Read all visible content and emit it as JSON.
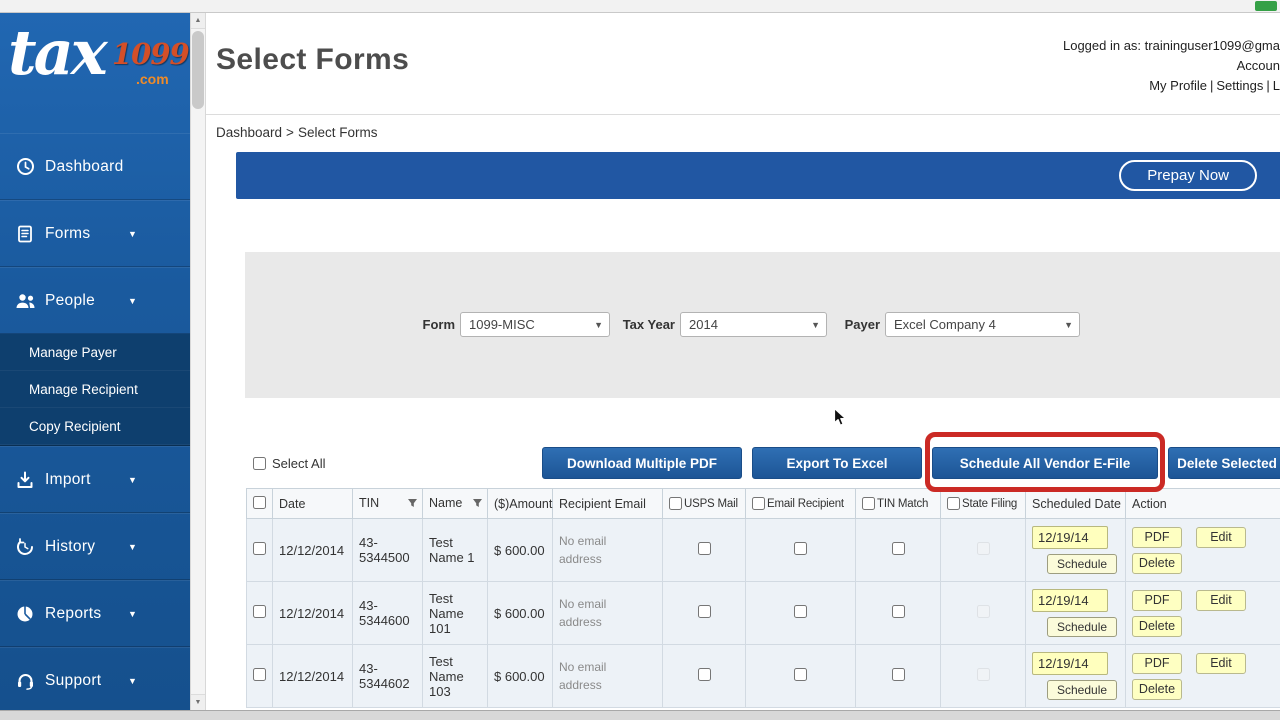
{
  "sidebar": {
    "logo": {
      "word": "tax",
      "number": "1099",
      "domain": ".com"
    },
    "items": [
      {
        "label": "Dashboard",
        "icon": "dashboard-clock-icon",
        "has_arrow": false
      },
      {
        "label": "Forms",
        "icon": "forms-icon",
        "has_arrow": true
      },
      {
        "label": "People",
        "icon": "people-icon",
        "has_arrow": true
      },
      {
        "label": "Import",
        "icon": "import-icon",
        "has_arrow": true
      },
      {
        "label": "History",
        "icon": "history-icon",
        "has_arrow": true
      },
      {
        "label": "Reports",
        "icon": "reports-pie-icon",
        "has_arrow": true
      },
      {
        "label": "Support",
        "icon": "support-headset-icon",
        "has_arrow": true
      }
    ],
    "people_submenu": [
      "Manage Payer",
      "Manage Recipient",
      "Copy Recipient"
    ]
  },
  "header": {
    "title": "Select Forms",
    "logged_in": "Logged in as: traininguser1099@gma",
    "account_line": "Accoun",
    "links": {
      "profile": "My Profile",
      "settings": "Settings",
      "logout": "L",
      "separator": "|"
    }
  },
  "breadcrumb": {
    "home": "Dashboard",
    "separator": ">",
    "current": "Select Forms"
  },
  "action_bar": {
    "prepay_button": "Prepay Now"
  },
  "filters": {
    "form": {
      "label": "Form",
      "value": "1099-MISC"
    },
    "tax_year": {
      "label": "Tax Year",
      "value": "2014"
    },
    "payer": {
      "label": "Payer",
      "value": "Excel Company 4"
    }
  },
  "toolbar": {
    "select_all": "Select All",
    "download_pdf": "Download Multiple PDF",
    "export_excel": "Export To Excel",
    "schedule_all": "Schedule All Vendor E-File",
    "delete_selected": "Delete Selected"
  },
  "table": {
    "headers": {
      "date": "Date",
      "tin": "TIN",
      "name": "Name",
      "amount": "($)Amount",
      "recipient_email": "Recipient Email",
      "usps": "USPS Mail",
      "email_recipient": "Email Recipient",
      "tin_match": "TIN Match",
      "state_filing": "State Filing",
      "scheduled_date": "Scheduled Date",
      "action": "Action"
    },
    "rows": [
      {
        "date": "12/12/2014",
        "tin": "43-5344500",
        "name": "Test Name 1",
        "amount": "$ 600.00",
        "recipient_email": "No email address",
        "scheduled_date": "12/19/14"
      },
      {
        "date": "12/12/2014",
        "tin": "43-5344600",
        "name": "Test Name 101",
        "amount": "$ 600.00",
        "recipient_email": "No email address",
        "scheduled_date": "12/19/14"
      },
      {
        "date": "12/12/2014",
        "tin": "43-5344602",
        "name": "Test Name 103",
        "amount": "$ 600.00",
        "recipient_email": "No email address",
        "scheduled_date": "12/19/14"
      }
    ],
    "row_buttons": {
      "pdf": "PDF",
      "edit": "Edit",
      "delete": "Delete",
      "schedule": "Schedule"
    }
  },
  "colors": {
    "sidebar_blue_top": "#2167b2",
    "sidebar_blue_bottom": "#15508d",
    "submenu_bg": "#0e3f6e",
    "band_blue": "#2157a3",
    "button_blue": "#1d5596",
    "highlight_red": "#cb2a25",
    "row_bg": "#edf2f7",
    "yellow_input": "#ffffbe",
    "yellow_button": "#feffc2",
    "logo_orange": "#ef8b28",
    "logo_red": "#d44f28"
  }
}
